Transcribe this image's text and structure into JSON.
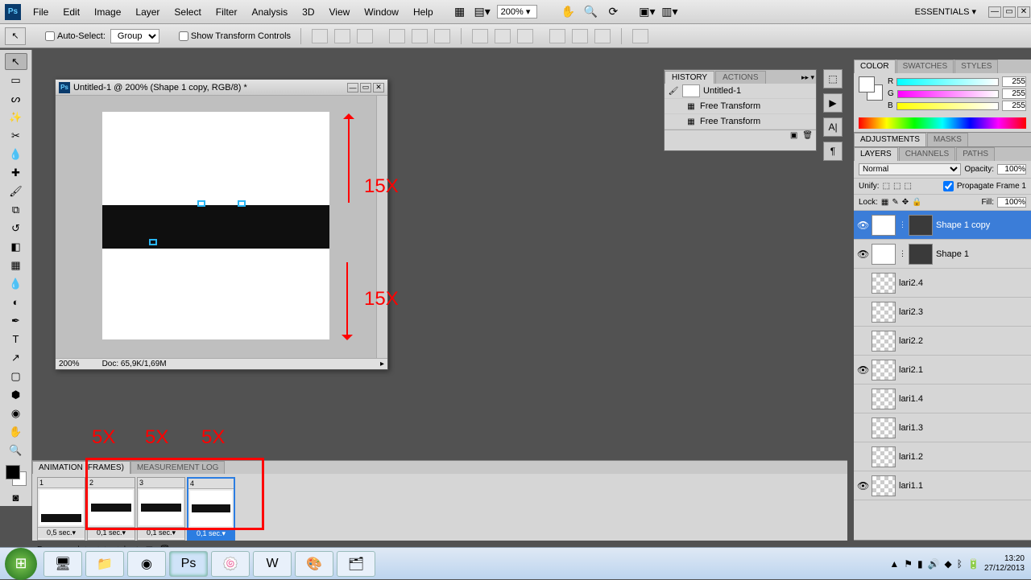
{
  "menu": {
    "items": [
      "File",
      "Edit",
      "Image",
      "Layer",
      "Select",
      "Filter",
      "Analysis",
      "3D",
      "View",
      "Window",
      "Help"
    ],
    "zoom": "200%",
    "essentials": "ESSENTIALS ▾"
  },
  "opt": {
    "autoSelect": "Auto-Select:",
    "autoSelectVal": "Group",
    "showTransform": "Show Transform Controls"
  },
  "doc": {
    "title": "Untitled-1 @ 200% (Shape 1 copy, RGB/8) *",
    "zoom": "200%",
    "status": "Doc: 65,9K/1,69M"
  },
  "ann": {
    "up": "15X",
    "down": "15X",
    "f1": "5X",
    "f2": "5X",
    "f3": "5X"
  },
  "history": {
    "tabs": [
      "HISTORY",
      "ACTIONS"
    ],
    "doc": "Untitled-1",
    "items": [
      "Free Transform",
      "Free Transform"
    ]
  },
  "color": {
    "tabs": [
      "COLOR",
      "SWATCHES",
      "STYLES"
    ],
    "r": "R",
    "g": "G",
    "b": "B",
    "rv": "255",
    "gv": "255",
    "bv": "255"
  },
  "adj": {
    "tabs": [
      "ADJUSTMENTS",
      "MASKS"
    ]
  },
  "layers": {
    "tabs": [
      "LAYERS",
      "CHANNELS",
      "PATHS"
    ],
    "blend": "Normal",
    "opacityLbl": "Opacity:",
    "opacity": "100%",
    "unify": "Unify:",
    "propagate": "Propagate Frame 1",
    "lockLbl": "Lock:",
    "fillLbl": "Fill:",
    "fill": "100%",
    "items": [
      {
        "name": "Shape 1 copy",
        "eye": true,
        "selected": true,
        "double": true
      },
      {
        "name": "Shape 1",
        "eye": true,
        "double": true
      },
      {
        "name": "lari2.4",
        "eye": false
      },
      {
        "name": "lari2.3",
        "eye": false
      },
      {
        "name": "lari2.2",
        "eye": false
      },
      {
        "name": "lari2.1",
        "eye": true
      },
      {
        "name": "lari1.4",
        "eye": false
      },
      {
        "name": "lari1.3",
        "eye": false
      },
      {
        "name": "lari1.2",
        "eye": false
      },
      {
        "name": "lari1.1",
        "eye": true
      }
    ]
  },
  "anim": {
    "tabs": [
      "ANIMATION (FRAMES)",
      "MEASUREMENT LOG"
    ],
    "frames": [
      {
        "n": "1",
        "t": "0,5 sec.▾",
        "barTop": 30
      },
      {
        "n": "2",
        "t": "0,1 sec.▾",
        "barTop": 17
      },
      {
        "n": "3",
        "t": "0,1 sec.▾",
        "barTop": 17
      },
      {
        "n": "4",
        "t": "0,1 sec.▾",
        "barTop": 17,
        "selected": true
      }
    ],
    "loop": "Forever"
  },
  "clock": {
    "time": "13:20",
    "date": "27/12/2013"
  }
}
